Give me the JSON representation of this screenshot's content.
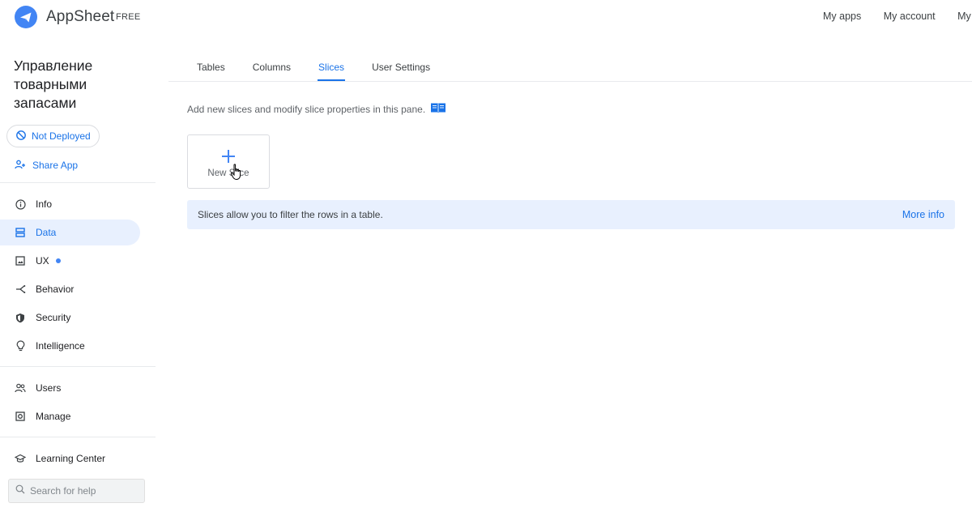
{
  "header": {
    "brand": "AppSheet",
    "plan": "FREE",
    "links": [
      "My apps",
      "My account",
      "My te"
    ]
  },
  "sidebar": {
    "app_name": "Управление товарными запасами",
    "deploy_status": "Not Deployed",
    "share_label": "Share App",
    "nav": [
      {
        "label": "Info",
        "icon": "info-icon"
      },
      {
        "label": "Data",
        "icon": "data-icon",
        "active": true
      },
      {
        "label": "UX",
        "icon": "ux-icon",
        "badge": true
      },
      {
        "label": "Behavior",
        "icon": "behavior-icon"
      },
      {
        "label": "Security",
        "icon": "shield-icon"
      },
      {
        "label": "Intelligence",
        "icon": "lightbulb-icon"
      }
    ],
    "nav2": [
      {
        "label": "Users",
        "icon": "users-icon"
      },
      {
        "label": "Manage",
        "icon": "manage-icon"
      }
    ],
    "learning": {
      "label": "Learning Center",
      "icon": "graduation-cap-icon"
    },
    "search_placeholder": "Search for help"
  },
  "tabs": [
    "Tables",
    "Columns",
    "Slices",
    "User Settings"
  ],
  "active_tab": "Slices",
  "main": {
    "intro": "Add new slices and modify slice properties in this pane.",
    "new_slice_label": "New Slice",
    "banner_text": "Slices allow you to filter the rows in a table.",
    "banner_link": "More info"
  },
  "colors": {
    "accent": "#1a73e8",
    "active_bg": "#e8f0fe",
    "logo": "#4285f4"
  }
}
